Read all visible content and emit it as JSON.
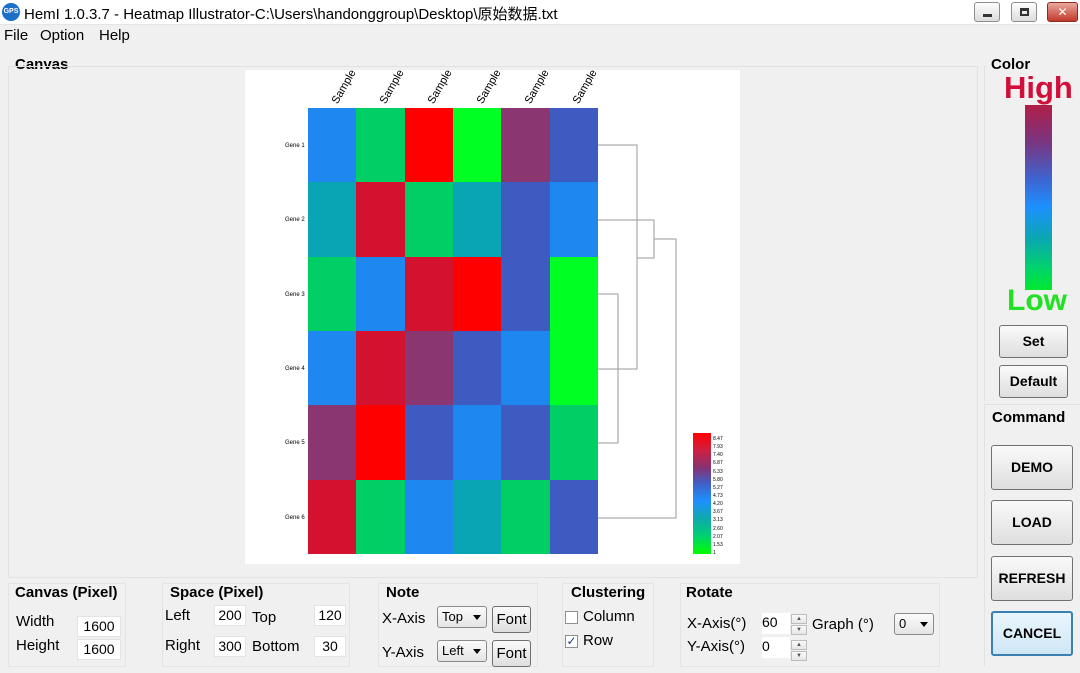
{
  "window": {
    "title": "HemI 1.0.3.7 - Heatmap Illustrator-C:\\Users\\handonggroup\\Desktop\\原始数据.txt",
    "app_icon": "GPS",
    "controls": [
      "minimize-icon",
      "maximize-icon",
      "close-icon"
    ]
  },
  "menu": [
    "File",
    "Option",
    "Help"
  ],
  "canvas": {
    "label": "Canvas",
    "column_labels": [
      "Sample",
      "Sample",
      "Sample",
      "Sample",
      "Sample",
      "Sample"
    ],
    "row_labels": [
      "Gene 1",
      "Gene 2",
      "Gene 3",
      "Gene 4",
      "Gene 5",
      "Gene 6"
    ],
    "legend_ticks": [
      "8.47",
      "7.93",
      "7.40",
      "6.87",
      "6.33",
      "5.80",
      "5.27",
      "4.73",
      "4.20",
      "3.67",
      "3.13",
      "2.60",
      "2.07",
      "1.53",
      "1"
    ],
    "colors": {
      "red": "#ff0000",
      "crimson": "#d2122e",
      "green": "#00ff22",
      "green2": "#00cf66",
      "teal": "#0aa5b5",
      "blue": "#1e88f0",
      "indigo": "#3e5bc2",
      "purple": "#8a3670"
    },
    "matrix": [
      [
        "blue",
        "green2",
        "red",
        "green",
        "purple",
        "indigo"
      ],
      [
        "teal",
        "crimson",
        "green2",
        "teal",
        "indigo",
        "blue"
      ],
      [
        "green2",
        "blue",
        "crimson",
        "red",
        "indigo",
        "green"
      ],
      [
        "blue",
        "crimson",
        "purple",
        "indigo",
        "blue",
        "green"
      ],
      [
        "purple",
        "red",
        "indigo",
        "blue",
        "indigo",
        "green2"
      ],
      [
        "crimson",
        "green2",
        "blue",
        "teal",
        "green2",
        "indigo"
      ]
    ]
  },
  "color_panel": {
    "label": "Color",
    "high_label": "High",
    "low_label": "Low",
    "set_button": "Set",
    "default_button": "Default"
  },
  "command": {
    "label": "Command",
    "demo_button": "DEMO",
    "load_button": "LOAD",
    "refresh_button": "REFRESH",
    "cancel_button": "CANCEL"
  },
  "canvas_pixel": {
    "label": "Canvas (Pixel)",
    "width_label": "Width",
    "width_value": "1600",
    "height_label": "Height",
    "height_value": "1600"
  },
  "space_pixel": {
    "label": "Space (Pixel)",
    "left_label": "Left",
    "left_value": "200",
    "top_label": "Top",
    "top_value": "120",
    "right_label": "Right",
    "right_value": "300",
    "bottom_label": "Bottom",
    "bottom_value": "30"
  },
  "note": {
    "label": "Note",
    "x_axis_label": "X-Axis",
    "x_axis_value": "Top",
    "y_axis_label": "Y-Axis",
    "y_axis_value": "Left",
    "font_button": "Font"
  },
  "clustering": {
    "label": "Clustering",
    "column_label": "Column",
    "column_checked": false,
    "row_label": "Row",
    "row_checked": true
  },
  "rotate": {
    "label": "Rotate",
    "x_axis_label": "X-Axis(°)",
    "x_axis_value": "60",
    "y_axis_label": "Y-Axis(°)",
    "y_axis_value": "0",
    "graph_label": "Graph (°)",
    "graph_value": "0"
  }
}
